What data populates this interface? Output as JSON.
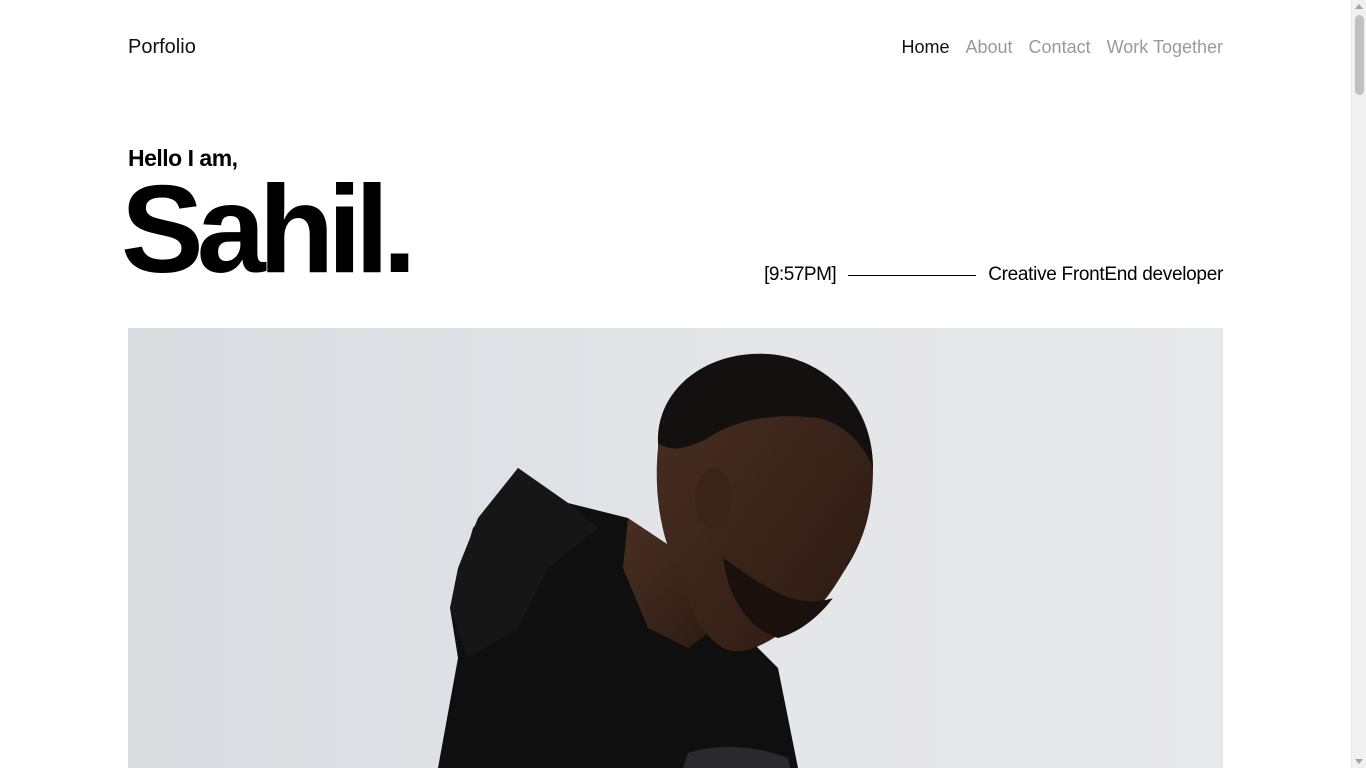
{
  "header": {
    "brand": "Porfolio",
    "nav": [
      {
        "label": "Home",
        "active": true
      },
      {
        "label": "About",
        "active": false
      },
      {
        "label": "Contact",
        "active": false
      },
      {
        "label": "Work Together",
        "active": false
      }
    ]
  },
  "hero": {
    "greeting": "Hello I am,",
    "name": "Sahil.",
    "time": "[9:57PM]",
    "role": "Creative FrontEnd developer"
  },
  "photo": {
    "subject": "portrait-photo"
  },
  "colors": {
    "text": "#111111",
    "nav_inactive": "#9a9a9a",
    "background": "#ffffff",
    "photo_bg": "#e4e5e9"
  }
}
